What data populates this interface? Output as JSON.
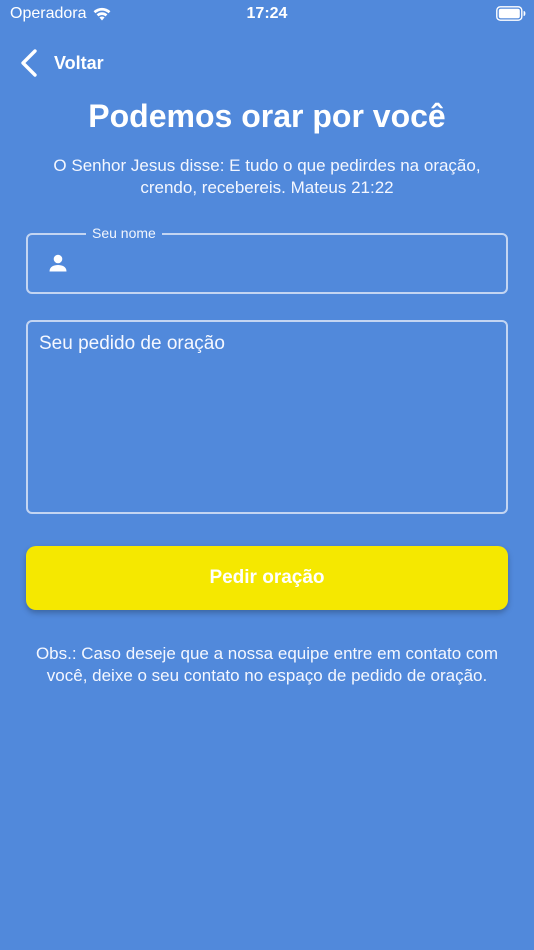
{
  "status_bar": {
    "carrier": "Operadora",
    "time": "17:24",
    "wifi_icon": "wifi-icon",
    "battery_icon": "battery-icon"
  },
  "nav": {
    "back_label": "Voltar",
    "back_icon": "chevron-left-icon"
  },
  "header": {
    "title": "Podemos orar por você",
    "verse": "O Senhor Jesus disse: E tudo o que pedirdes na oração, crendo, recebereis. Mateus 21:22"
  },
  "form": {
    "name_label": "Seu nome",
    "name_value": "",
    "name_icon": "person-icon",
    "request_placeholder": "Seu pedido de oração",
    "request_value": "",
    "submit_label": "Pedir oração"
  },
  "footer": {
    "note": "Obs.:  Caso deseje que a nossa equipe entre em contato com você, deixe o seu contato no espaço de pedido de oração."
  },
  "colors": {
    "background": "#5189db",
    "button": "#f5e800",
    "text": "#ffffff",
    "field_border": "#c3d5f2"
  }
}
